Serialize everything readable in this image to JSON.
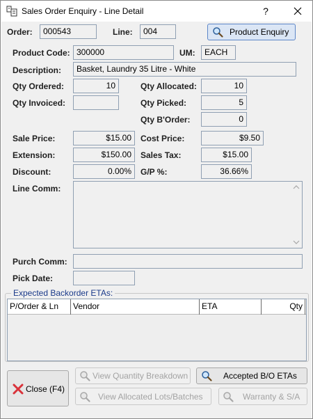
{
  "window": {
    "title": "Sales Order Enquiry - Line Detail",
    "help_label": "?"
  },
  "header": {
    "order_label": "Order:",
    "order_value": "000543",
    "line_label": "Line:",
    "line_value": "004",
    "product_enquiry_label": "Product Enquiry"
  },
  "product": {
    "code_label": "Product Code:",
    "code_value": "300000",
    "um_label": "UM:",
    "um_value": "EACH",
    "description_label": "Description:",
    "description_value": "Basket, Laundry 35 Litre - White"
  },
  "quantities": {
    "qty_ordered_label": "Qty Ordered:",
    "qty_ordered_value": "10",
    "qty_allocated_label": "Qty Allocated:",
    "qty_allocated_value": "10",
    "qty_invoiced_label": "Qty Invoiced:",
    "qty_invoiced_value": "",
    "qty_picked_label": "Qty Picked:",
    "qty_picked_value": "5",
    "qty_border_label": "Qty B'Order:",
    "qty_border_value": "0"
  },
  "pricing": {
    "sale_price_label": "Sale Price:",
    "sale_price_value": "$15.00",
    "cost_price_label": "Cost Price:",
    "cost_price_value": "$9.50",
    "extension_label": "Extension:",
    "extension_value": "$150.00",
    "sales_tax_label": "Sales Tax:",
    "sales_tax_value": "$15.00",
    "discount_label": "Discount:",
    "discount_value": "0.00%",
    "gp_label": "G/P %:",
    "gp_value": "36.66%"
  },
  "comments": {
    "line_comm_label": "Line Comm:",
    "line_comm_value": "",
    "purch_comm_label": "Purch Comm:",
    "purch_comm_value": "",
    "pick_date_label": "Pick Date:",
    "pick_date_value": ""
  },
  "backorder": {
    "group_title": "Expected Backorder ETAs:",
    "columns": [
      "P/Order & Ln",
      "Vendor",
      "ETA",
      "Qty"
    ],
    "rows": []
  },
  "buttons": {
    "close_label": "Close (F4)",
    "view_qty_breakdown_label": "View Quantity Breakdown",
    "accepted_bo_label": "Accepted B/O ETAs",
    "view_allocated_label": "View Allocated Lots/Batches",
    "warranty_label": "Warranty & S/A"
  },
  "colors": {
    "group_title": "#1a3a8a",
    "field_border": "#8f9fb2",
    "client_bg": "#f0f0f0",
    "close_icon": "#d9323a"
  }
}
